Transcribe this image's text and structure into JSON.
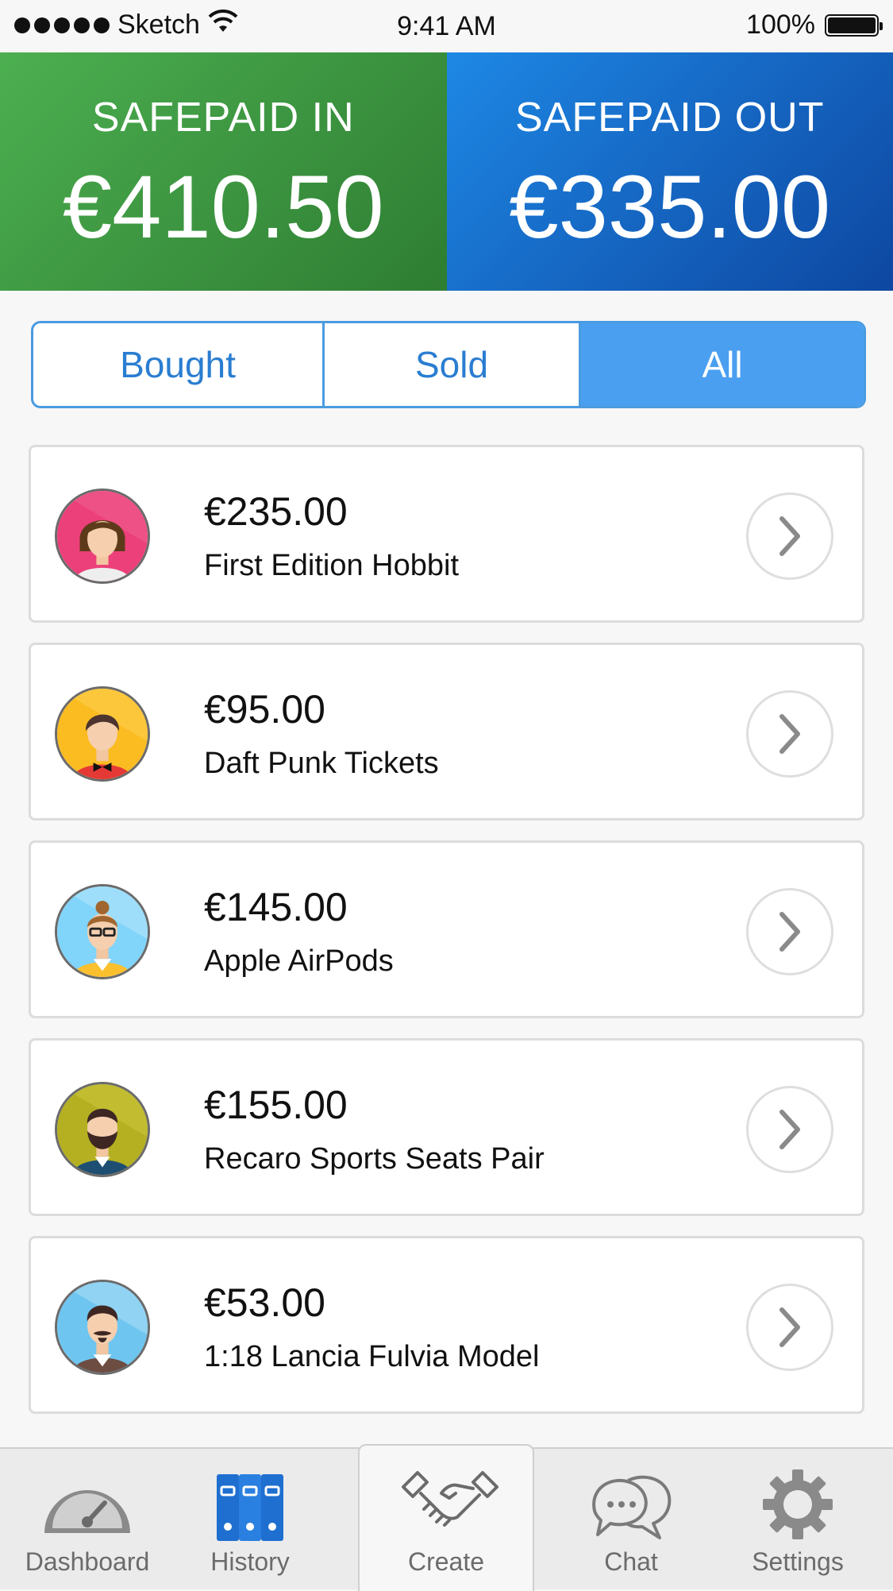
{
  "status_bar": {
    "carrier": "Sketch",
    "time": "9:41 AM",
    "battery": "100%"
  },
  "summary": {
    "in": {
      "label": "SAFEPAID IN",
      "amount": "€410.50",
      "color": "#43a047"
    },
    "out": {
      "label": "SAFEPAID OUT",
      "amount": "€335.00",
      "color": "#1565c0"
    }
  },
  "segments": {
    "items": [
      "Bought",
      "Sold",
      "All"
    ],
    "selected": "All",
    "accent": "#4a9ff0"
  },
  "transactions": [
    {
      "price": "€235.00",
      "title": "First Edition Hobbit",
      "avatar": "woman-avatar-icon"
    },
    {
      "price": "€95.00",
      "title": "Daft Punk Tickets",
      "avatar": "man-bowtie-avatar-icon"
    },
    {
      "price": "€145.00",
      "title": "Apple AirPods",
      "avatar": "woman-glasses-avatar-icon"
    },
    {
      "price": "€155.00",
      "title": "Recaro Sports Seats Pair",
      "avatar": "bearded-man-avatar-icon"
    },
    {
      "price": "€53.00",
      "title": "1:18 Lancia Fulvia Model",
      "avatar": "mustache-man-avatar-icon"
    }
  ],
  "tabbar": {
    "dashboard": "Dashboard",
    "history": "History",
    "create": "Create",
    "chat": "Chat",
    "settings": "Settings",
    "active": "Create"
  }
}
